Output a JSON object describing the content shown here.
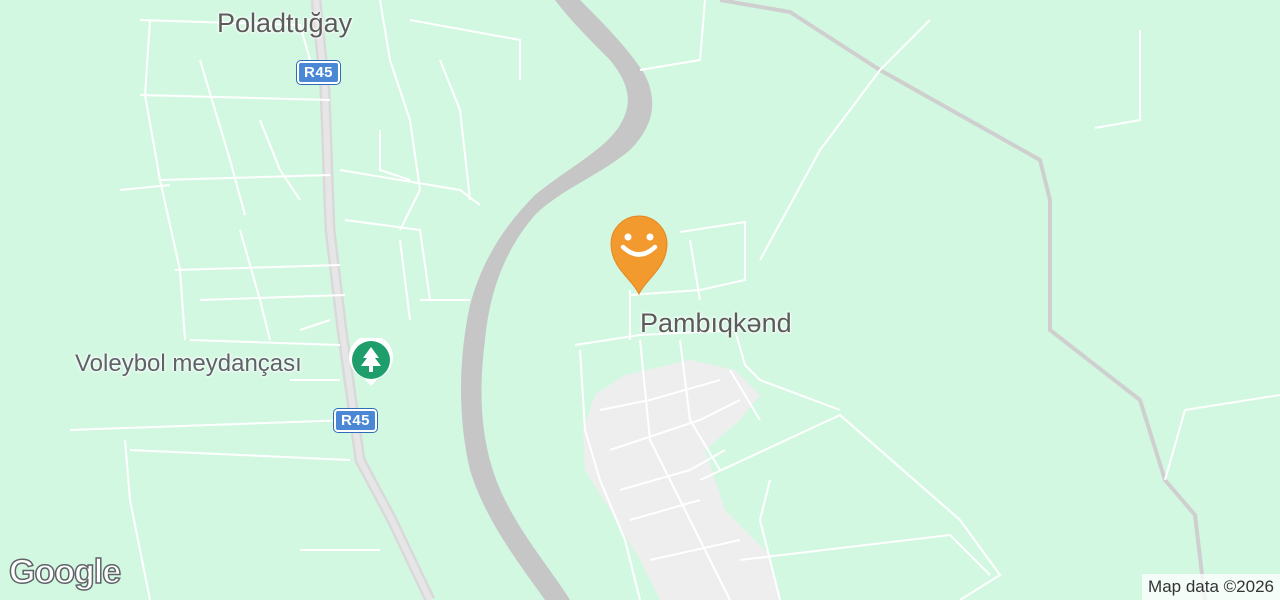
{
  "map": {
    "labels": {
      "poladtugay": "Poladtuğay",
      "pambiqkend": "Pambıqkənd",
      "voleybol": "Voleybol meydançası"
    },
    "shields": {
      "r45_top": "R45",
      "r45_bottom": "R45"
    },
    "icons": {
      "park": "tree-icon",
      "marker": "smiley-face-icon"
    },
    "colors": {
      "land": "#d3f8e2",
      "river": "#c6c6c6",
      "road": "#ffffff",
      "town_area": "#eeeeee",
      "highway": "#d9d9d9",
      "marker": "#f29a2e",
      "poi_green": "#1e9e6a",
      "shield": "#4a88d6"
    }
  },
  "footer": {
    "logo": "Google",
    "attribution": "Map data ©2026"
  }
}
